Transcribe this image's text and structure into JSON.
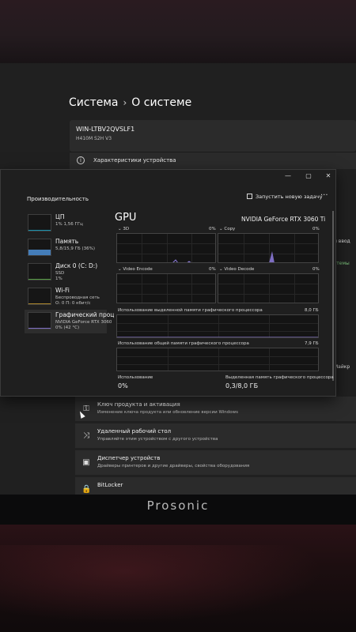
{
  "settings": {
    "breadcrumb_parent": "Система",
    "breadcrumb_sep": "›",
    "breadcrumb_current": "О системе",
    "device_name": "WIN-LTBV2QVSLF1",
    "device_model": "H410M S2H V3",
    "specs_label": "Характеристики устройства",
    "side_text_1": "й ввод",
    "side_text_2": "стемы",
    "side_text_3": "Майкр",
    "rows": [
      {
        "title": "Ключ продукта и активация",
        "subtitle": "Изменение ключа продукта или обновление версии Windows"
      },
      {
        "title": "Удаленный рабочий стол",
        "subtitle": "Управляйте этим устройством с другого устройства"
      },
      {
        "title": "Диспетчер устройств",
        "subtitle": "Драйверы принтеров и другие драйверы, свойства оборудования"
      },
      {
        "title": "BitLocker",
        "subtitle": ""
      }
    ]
  },
  "taskmanager": {
    "window_buttons": {
      "min": "—",
      "max": "▢",
      "close": "✕"
    },
    "title": "Производительность",
    "run_task": "Запустить новую задачу",
    "more": "···",
    "items": [
      {
        "name": "ЦП",
        "detail1": "1% 1,56 ГГц",
        "detail2": "",
        "color": "#17a8c9",
        "level": 0.02
      },
      {
        "name": "Память",
        "detail1": "5,8/15,9 ГБ (36%)",
        "detail2": "",
        "color": "#4c8fd6",
        "level": 0.36
      },
      {
        "name": "Диск 0 (C: D:)",
        "detail1": "SSD",
        "detail2": "1%",
        "color": "#5fb34a",
        "level": 0.01
      },
      {
        "name": "Wi-Fi",
        "detail1": "Беспроводная сеть",
        "detail2": "О: 0 П: 0 кбит/с",
        "color": "#c59a2f",
        "level": 0.0
      },
      {
        "name": "Графический проц",
        "detail1": "NVIDIA GeForce RTX 3060",
        "detail2": "0% (42 °C)",
        "color": "#8f7de0",
        "level": 0.0
      }
    ],
    "gpu": {
      "title": "GPU",
      "model": "NVIDIA GeForce RTX 3060 Ti",
      "engines": [
        {
          "label": "3D",
          "value": "0%"
        },
        {
          "label": "Copy",
          "value": "0%"
        },
        {
          "label": "Video Encode",
          "value": "0%"
        },
        {
          "label": "Video Decode",
          "value": "0%"
        }
      ],
      "dedicated_label": "Использование выделенной памяти графического процессора",
      "dedicated_max": "8,0 ГБ",
      "shared_label": "Использование общей памяти графического процессора",
      "shared_max": "7,9 ГБ",
      "usage_label": "Использование",
      "usage_value": "0%",
      "dedicated_mem_label": "Выделенная память графического процессора",
      "dedicated_mem_value": "0,3/8,0 ГБ"
    }
  },
  "monitor_brand": "Prosonic"
}
